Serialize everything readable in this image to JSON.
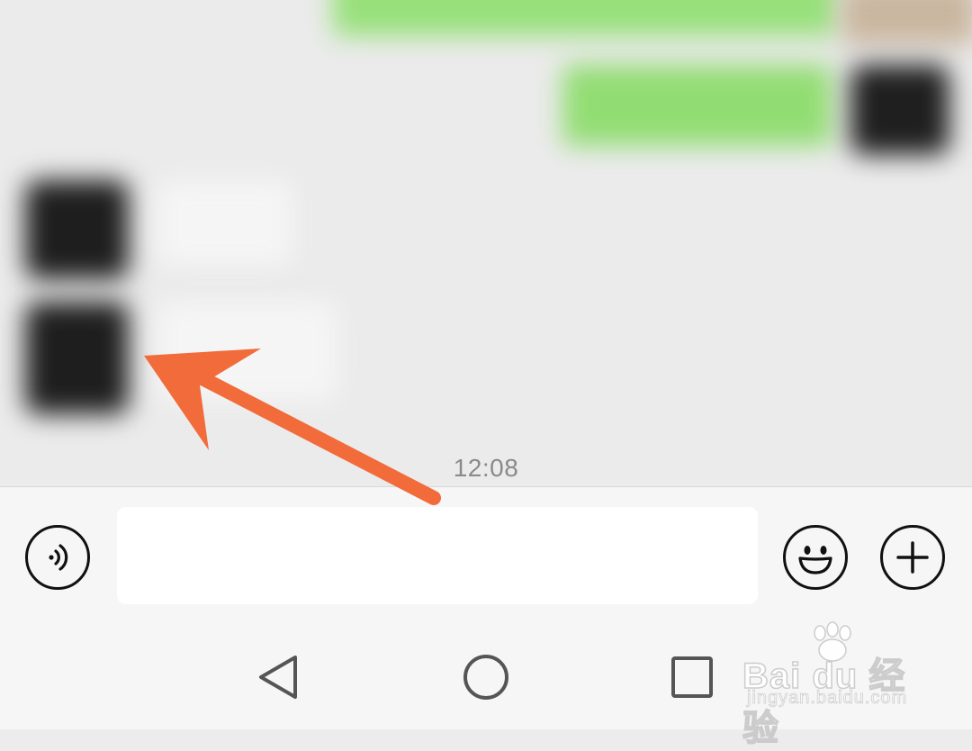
{
  "chat": {
    "timestamp": "12:08"
  },
  "input_bar": {
    "voice_icon": "voice-input-icon",
    "emoji_icon": "emoji-icon",
    "plus_icon": "plus-icon",
    "message_value": ""
  },
  "nav_bar": {
    "back_icon": "back-triangle-icon",
    "home_icon": "home-circle-icon",
    "recent_icon": "recent-apps-square-icon"
  },
  "watermark": {
    "brand": "Bai du 经验",
    "url": "jingyan.baidu.com"
  },
  "colors": {
    "annotation_arrow": "#f26b3a",
    "sent_bubble": "#95e06f",
    "avatar_dark": "#1e1e1e"
  }
}
